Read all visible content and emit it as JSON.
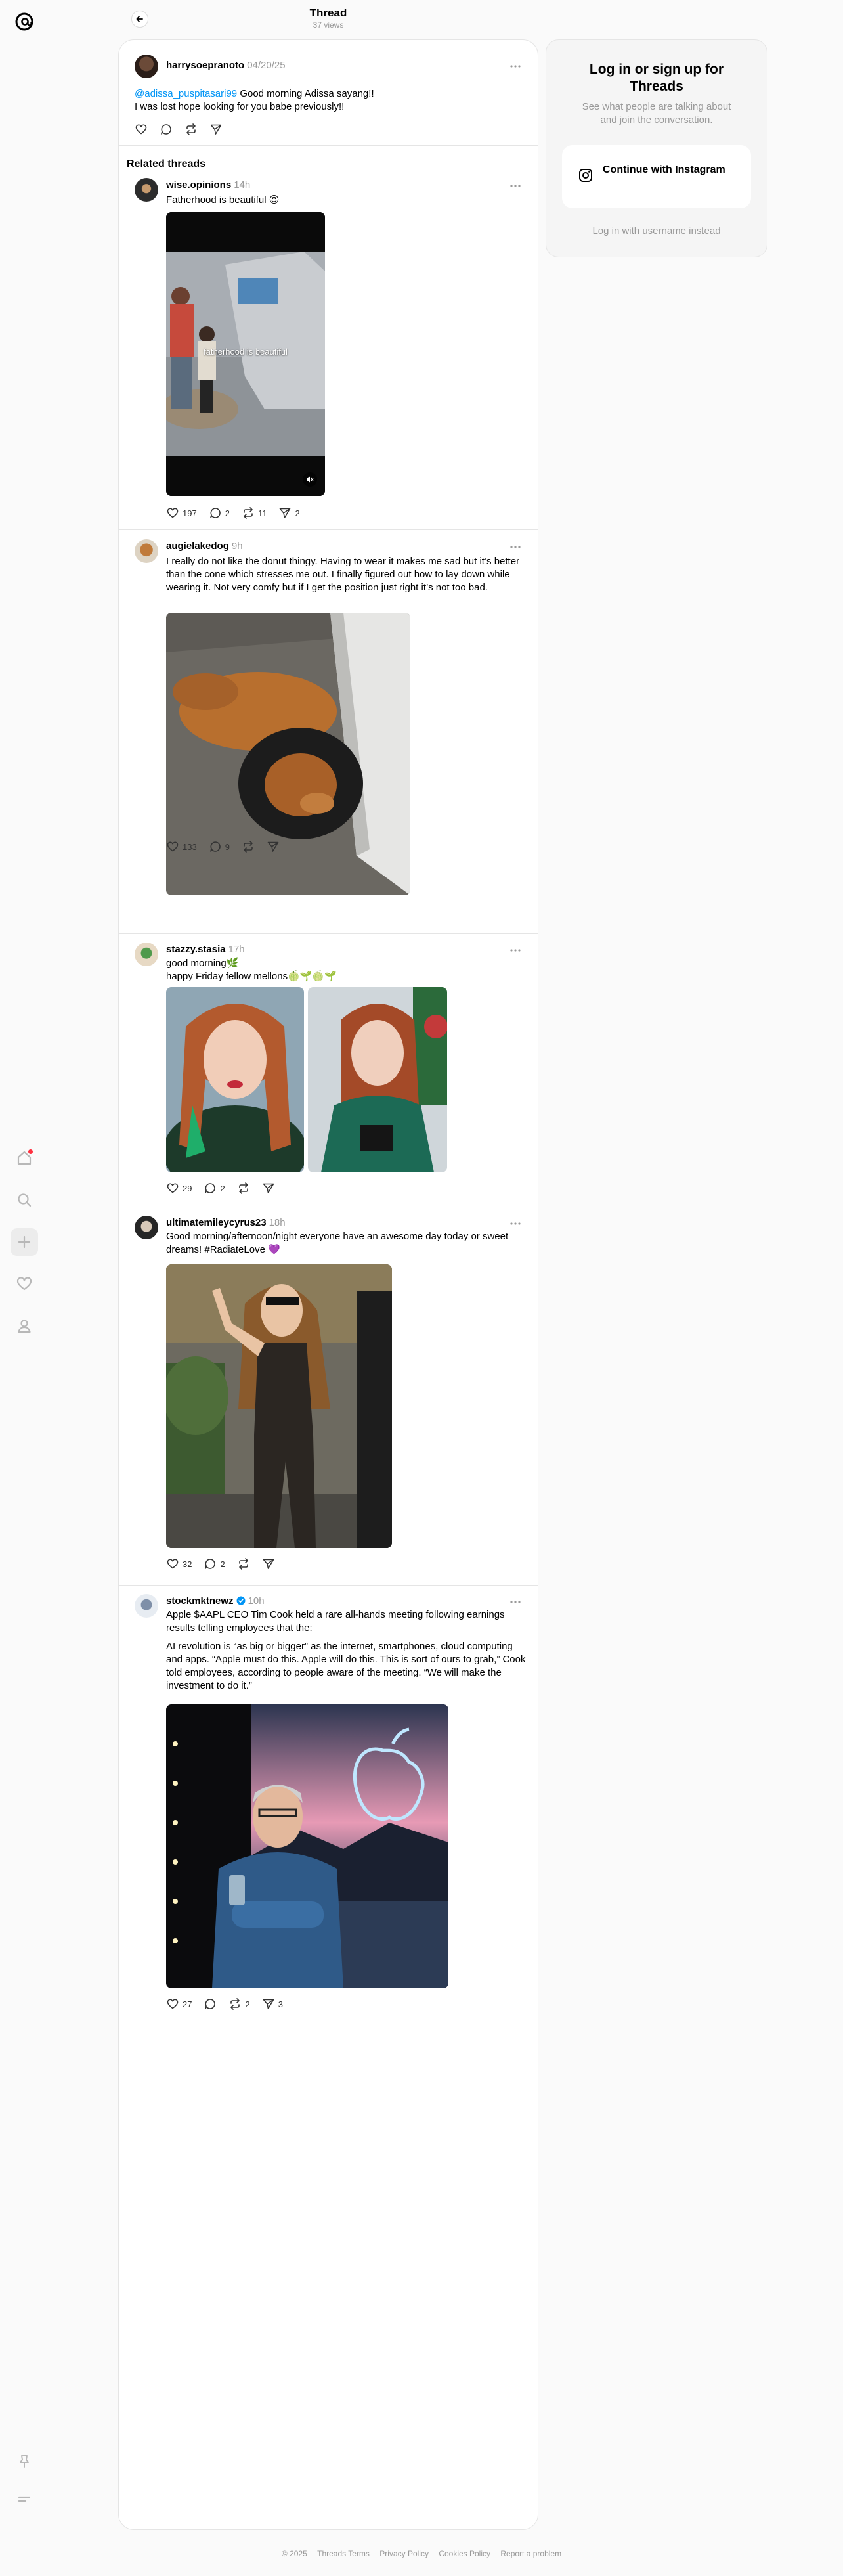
{
  "header": {
    "title": "Thread",
    "views": "37 views"
  },
  "main_post": {
    "username": "harrysoepranoto",
    "date": "04/20/25",
    "mention": "@adissa_puspitasari99",
    "line1": " Good morning Adissa sayang!!",
    "line2": "I was lost hope looking for you babe previously!!"
  },
  "related_label": "Related threads",
  "posts": [
    {
      "username": "wise.opinions",
      "time": "14h",
      "text": "Fatherhood is beautiful 😍",
      "media_caption": "fatherhood is beautiful",
      "likes": "197",
      "replies": "2",
      "reposts": "11",
      "shares": "2"
    },
    {
      "username": "augielakedog",
      "time": "9h",
      "text": "I really do not like the donut thingy. Having to wear it makes me sad but it’s better than the cone which stresses me out. I finally figured out how to lay down while wearing it. Not very comfy but if I get the position just right it’s not too bad.",
      "likes": "133",
      "replies": "9",
      "reposts": "",
      "shares": ""
    },
    {
      "username": "stazzy.stasia",
      "time": "17h",
      "line1": "good morning🌿",
      "line2": "happy Friday fellow mellons🍈🌱🍈🌱",
      "likes": "29",
      "replies": "2",
      "reposts": "",
      "shares": ""
    },
    {
      "username": "ultimatemileycyrus23",
      "time": "18h",
      "text": "Good morning/afternoon/night everyone have an awesome day today or sweet dreams! #RadiateLove 💜",
      "likes": "32",
      "replies": "2",
      "reposts": "",
      "shares": ""
    },
    {
      "username": "stockmktnewz",
      "time": "10h",
      "para1": "Apple $AAPL CEO Tim Cook held a rare all-hands meeting following earnings results telling employees that the:",
      "para2": "AI revolution is “as big or bigger” as the internet, smartphones, cloud computing and apps. “Apple must do this. Apple will do this. This is sort of ours to grab,” Cook told employees, according to people aware of the meeting. “We will make the investment to do it.”",
      "likes": "27",
      "replies": "",
      "reposts": "2",
      "shares": "3"
    }
  ],
  "login": {
    "title": "Log in or sign up for Threads",
    "subtitle": "See what people are talking about and join the conversation.",
    "instagram_button": "Continue with Instagram",
    "alt_link": "Log in with username instead"
  },
  "footer": {
    "copyright": "© 2025",
    "links": [
      "Threads Terms",
      "Privacy Policy",
      "Cookies Policy",
      "Report a problem"
    ]
  },
  "colors": {
    "accent_link": "#0095f6",
    "muted": "#999999",
    "notification_dot": "#ff3040",
    "verified": "#0095f6"
  },
  "icons": [
    "threads-logo-icon",
    "home-icon",
    "search-icon",
    "plus-icon",
    "heart-icon",
    "profile-icon",
    "pin-icon",
    "menu-icon",
    "back-arrow-icon",
    "more-icon",
    "reply-icon",
    "repost-icon",
    "share-icon",
    "instagram-icon",
    "verified-icon",
    "mute-icon"
  ]
}
